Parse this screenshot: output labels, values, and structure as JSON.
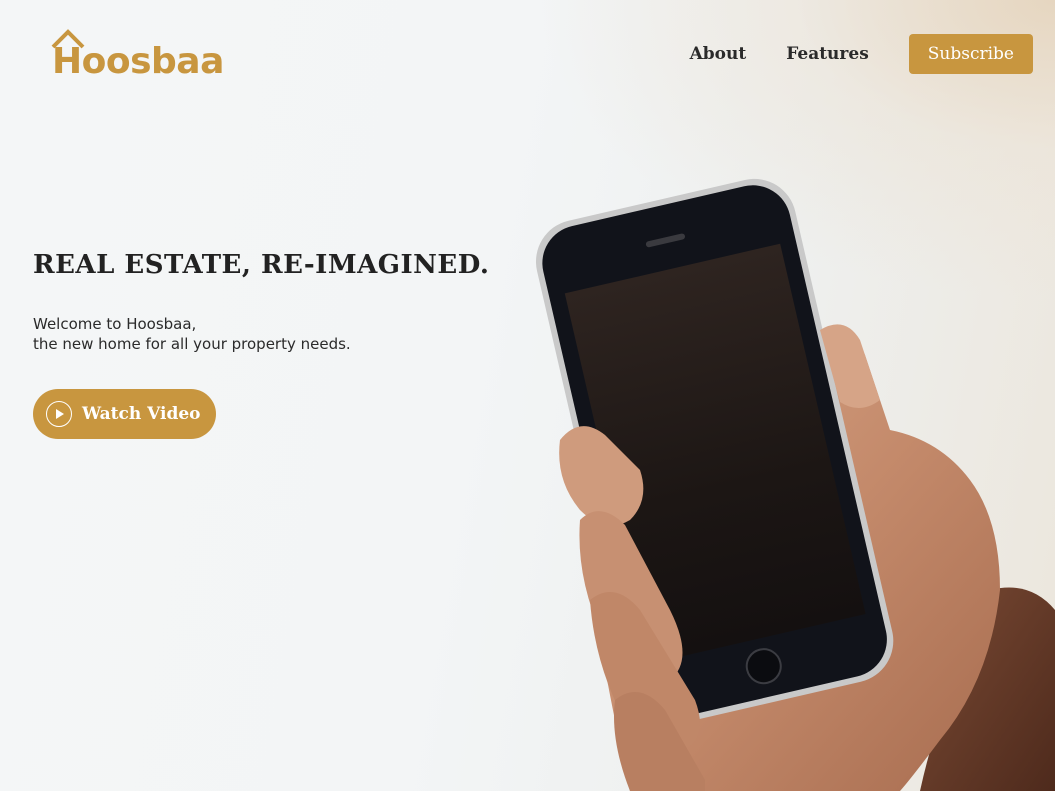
{
  "brand": {
    "name": "Hoosbaa",
    "accent_color": "#c8963f"
  },
  "nav": {
    "links": [
      {
        "label": "About"
      },
      {
        "label": "Features"
      }
    ],
    "subscribe_label": "Subscribe"
  },
  "hero": {
    "title": "REAL ESTATE, RE-IMAGINED.",
    "subtitle_line1": "Welcome to Hoosbaa,",
    "subtitle_line2": "the new home for all your property needs.",
    "cta_label": "Watch Video",
    "cta_icon": "play-icon"
  }
}
